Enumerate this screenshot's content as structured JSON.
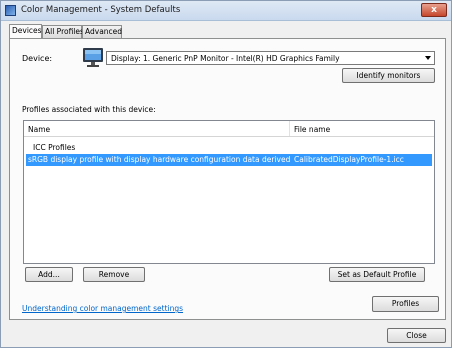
{
  "window": {
    "title": "Color Management - System Defaults",
    "close_glyph": "x"
  },
  "tabs": [
    {
      "label": "Devices",
      "active": true
    },
    {
      "label": "All Profiles"
    },
    {
      "label": "Advanced"
    }
  ],
  "device": {
    "label": "Device:",
    "selected": "Display: 1. Generic PnP Monitor - Intel(R) HD Graphics Family",
    "identify_button": "Identify monitors",
    "icon": "monitor-icon"
  },
  "profiles": {
    "section_label": "Profiles associated with this device:",
    "columns": {
      "name": "Name",
      "file": "File name"
    },
    "group": "ICC Profiles",
    "rows": [
      {
        "name": "sRGB display profile with display hardware configuration data derived from calibration",
        "file": "CalibratedDisplayProfile-1.icc",
        "selected": true
      }
    ]
  },
  "buttons": {
    "add": "Add...",
    "remove": "Remove",
    "set_default": "Set as Default Profile",
    "profiles": "Profiles",
    "close": "Close"
  },
  "help_link": "Understanding color management settings",
  "colors": {
    "selection": "#3399ff",
    "link": "#0066cc"
  }
}
